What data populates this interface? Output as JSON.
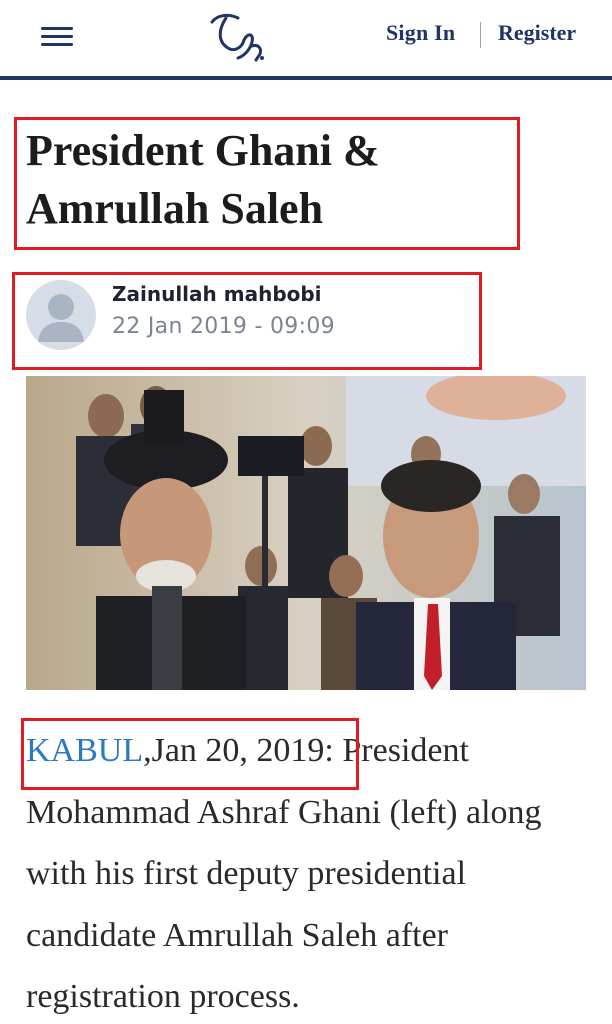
{
  "header": {
    "menu_icon": "hamburger-menu-icon",
    "logo_icon": "calligraphy-logo-icon",
    "sign_in": "Sign In",
    "register": "Register",
    "accent": "#1f3566"
  },
  "article": {
    "title": "President Ghani & Amrullah Saleh",
    "author": "Zainullah mahbobi",
    "datetime": "22 Jan 2019 - 09:09",
    "place": "KABUL",
    "dateline_rest": ",Jan 20, 2019:",
    "body": " President Mohammad Ashraf Ghani (left) along with his first deputy presidential candidate Amrullah Saleh after registration process."
  },
  "highlight_color": "#e01b24",
  "link_color": "#2a78c6"
}
